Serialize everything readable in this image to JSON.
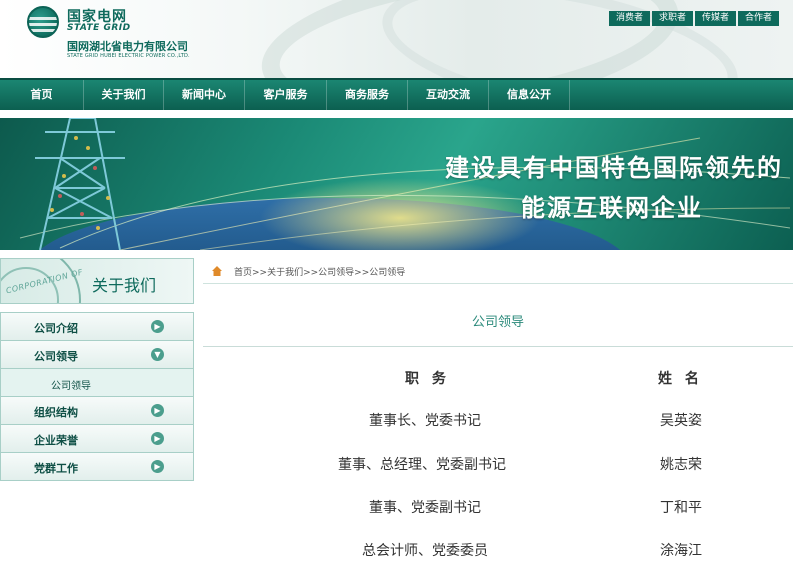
{
  "header": {
    "logo_cn": "国家电网",
    "logo_en": "STATE GRID",
    "company_cn": "国网湖北省电力有限公司",
    "company_en": "STATE GRID HUBEI ELECTRIC POWER CO.,LTD.",
    "quick_links": [
      "消费者",
      "求职者",
      "传媒者",
      "合作者"
    ]
  },
  "nav": {
    "items": [
      "首页",
      "关于我们",
      "新闻中心",
      "客户服务",
      "商务服务",
      "互动交流",
      "信息公开"
    ]
  },
  "banner": {
    "line1": "建设具有中国特色国际领先的",
    "line2": "能源互联网企业"
  },
  "sidebar": {
    "seal_text": "CORPORATION OF",
    "title": "关于我们",
    "items": [
      {
        "label": "公司介绍",
        "icon": "arrow-right-icon"
      },
      {
        "label": "公司领导",
        "icon": "arrow-down-icon"
      },
      {
        "label": "公司领导",
        "sub": true
      },
      {
        "label": "组织结构",
        "icon": "arrow-right-icon"
      },
      {
        "label": "企业荣誉",
        "icon": "arrow-right-icon"
      },
      {
        "label": "党群工作",
        "icon": "arrow-right-icon"
      }
    ]
  },
  "content": {
    "breadcrumb": "首页>>关于我们>>公司领导>>公司领导",
    "title": "公司领导",
    "headers": {
      "position": "职 务",
      "name": "姓 名"
    },
    "rows": [
      {
        "position": "董事长、党委书记",
        "name": "吴英姿"
      },
      {
        "position": "董事、总经理、党委副书记",
        "name": "姚志荣"
      },
      {
        "position": "董事、党委副书记",
        "name": "丁和平"
      },
      {
        "position": "总会计师、党委委员",
        "name": "涂海江"
      }
    ]
  },
  "colors": {
    "brand": "#0e6a5c",
    "nav": "#14735f",
    "accent": "#2b8a7b"
  }
}
